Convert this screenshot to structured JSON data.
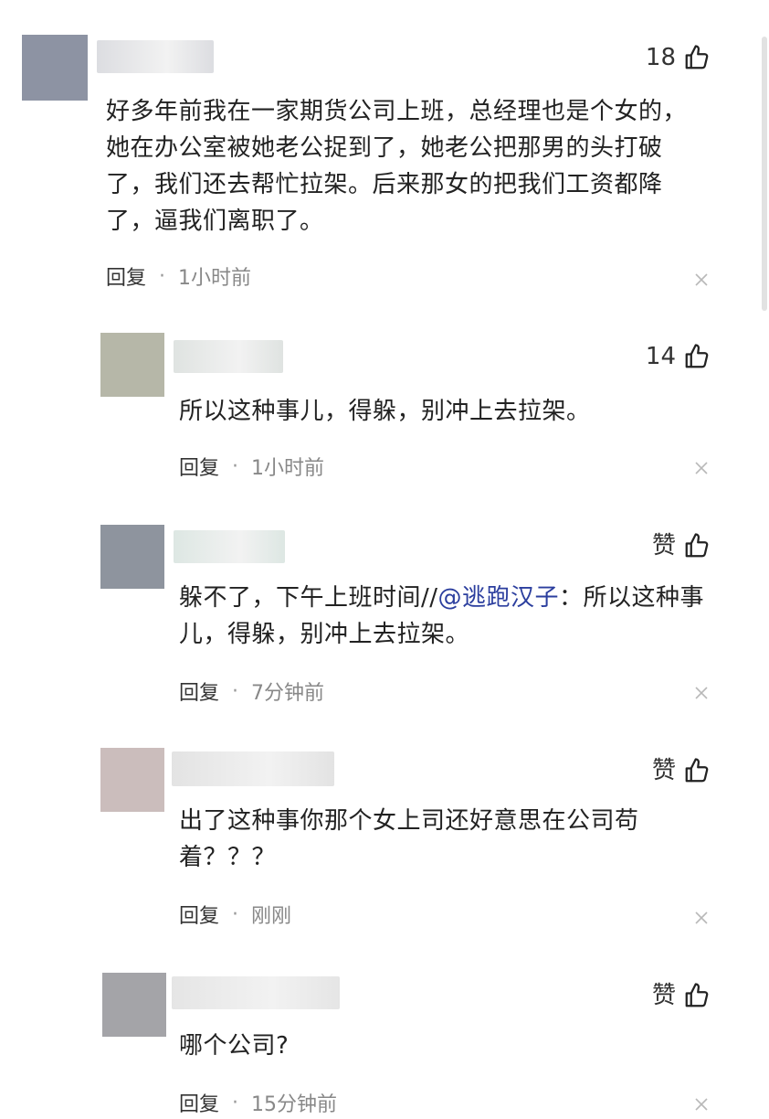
{
  "comments": [
    {
      "likes": "18",
      "text": "好多年前我在一家期货公司上班，总经理也是个女的，她在办公室被她老公捉到了，她老公把那男的头打破了，我们还去帮忙拉架。后来那女的把我们工资都降了，逼我们离职了。",
      "reply": "回复",
      "time": "1小时前",
      "avatar_color": "#8d93a3",
      "name_color": "#dcdde1"
    },
    {
      "likes": "14",
      "text": "所以这种事儿，得躲，别冲上去拉架。",
      "reply": "回复",
      "time": "1小时前",
      "avatar_color": "#b6b7a8",
      "name_color": "#dfe3e1"
    },
    {
      "likes": "赞",
      "text_prefix": "躲不了，下午上班时间//",
      "mention": "@逃跑汉子",
      "text_suffix": "：所以这种事儿，得躲，别冲上去拉架。",
      "reply": "回复",
      "time": "7分钟前",
      "avatar_color": "#8e949e",
      "name_color": "#dde7e3"
    },
    {
      "likes": "赞",
      "text": "出了这种事你那个女上司还好意思在公司苟着？？？",
      "reply": "回复",
      "time": "刚刚",
      "avatar_color": "#cbbdbc",
      "name_color": "#e3e3e3"
    },
    {
      "likes": "赞",
      "text": "哪个公司?",
      "reply": "回复",
      "time": "15分钟前",
      "avatar_color": "#a4a4a8",
      "name_color": "#e5e5e5"
    }
  ]
}
